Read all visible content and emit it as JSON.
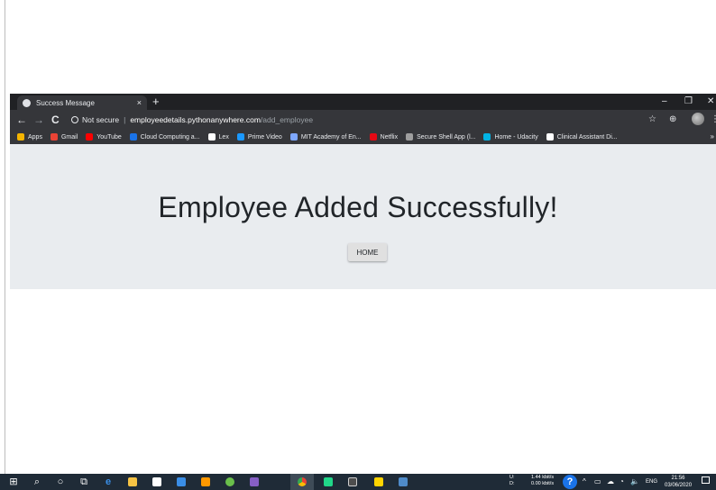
{
  "browser": {
    "tab": {
      "title": "Success Message",
      "close": "×"
    },
    "new_tab": "+",
    "window_controls": {
      "minimize": "–",
      "maximize": "❐",
      "close": "✕"
    },
    "nav": {
      "back": "←",
      "forward": "→",
      "reload": "C"
    },
    "address": {
      "security": "Not secure",
      "separator": "|",
      "host": "employeedetails.pythonanywhere.com",
      "path": "/add_employee"
    },
    "toolbar_icons": {
      "star": "☆",
      "extension": "⊕",
      "menu": "⋮"
    },
    "bookmarks": [
      {
        "label": "Apps",
        "color": "#f4b400"
      },
      {
        "label": "Gmail",
        "color": "#ea4335"
      },
      {
        "label": "YouTube",
        "color": "#ff0000"
      },
      {
        "label": "Cloud Computing a...",
        "color": "#1a73e8"
      },
      {
        "label": "Lex",
        "color": "#ffffff"
      },
      {
        "label": "Prime Video",
        "color": "#1a98ff"
      },
      {
        "label": "MIT Academy of En...",
        "color": "#7fa8ff"
      },
      {
        "label": "Netflix",
        "color": "#e50914"
      },
      {
        "label": "Secure Shell App (l...",
        "color": "#9e9e9e"
      },
      {
        "label": "Home - Udacity",
        "color": "#02b3e4"
      },
      {
        "label": "Clinical Assistant Di...",
        "color": "#ffffff"
      }
    ],
    "bookmarks_more": "»"
  },
  "page": {
    "headline": "Employee Added Successfully!",
    "home_button": "HOME"
  },
  "taskbar": {
    "network": {
      "upload_label": "U:",
      "download_label": "D:",
      "upload_speed": "1.44 kbit/s",
      "download_speed": "0.00 kbit/s"
    },
    "help_icon": "?",
    "language": "ENG",
    "time": "21:56",
    "date": "03/06/2020"
  },
  "colors": {
    "title_bar": "#202124",
    "toolbar": "#35363a",
    "page_background": "#e9ecef",
    "taskbar": "#1f2b37"
  }
}
